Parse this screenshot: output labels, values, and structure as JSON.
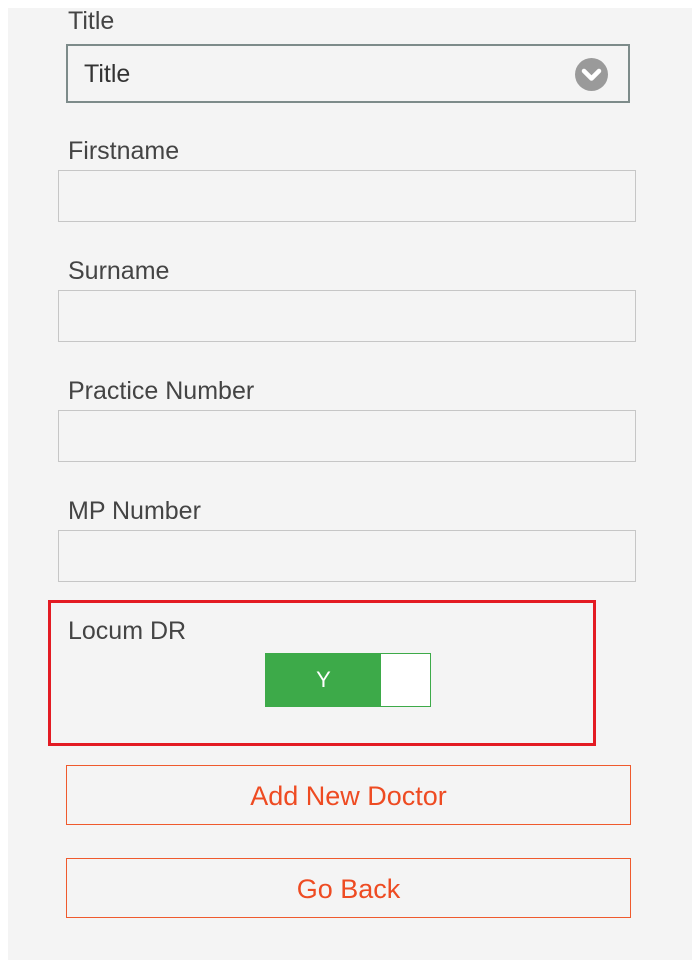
{
  "form": {
    "title": {
      "label": "Title",
      "value": "Title"
    },
    "firstname": {
      "label": "Firstname",
      "value": ""
    },
    "surname": {
      "label": "Surname",
      "value": ""
    },
    "practice_number": {
      "label": "Practice Number",
      "value": ""
    },
    "mp_number": {
      "label": "MP Number",
      "value": ""
    },
    "locum": {
      "label": "Locum DR",
      "toggle_text": "Y",
      "on": true
    }
  },
  "buttons": {
    "add": "Add New Doctor",
    "back": "Go Back"
  },
  "colors": {
    "toggle_on": "#3daa49",
    "highlight": "#e31b23",
    "button_text": "#ee4b22"
  }
}
